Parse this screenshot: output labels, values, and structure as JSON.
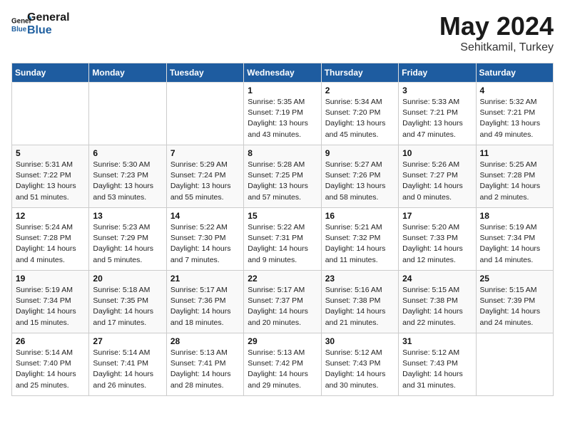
{
  "header": {
    "logo_line1": "General",
    "logo_line2": "Blue",
    "month": "May 2024",
    "location": "Sehitkamil, Turkey"
  },
  "weekdays": [
    "Sunday",
    "Monday",
    "Tuesday",
    "Wednesday",
    "Thursday",
    "Friday",
    "Saturday"
  ],
  "weeks": [
    [
      {
        "day": "",
        "info": ""
      },
      {
        "day": "",
        "info": ""
      },
      {
        "day": "",
        "info": ""
      },
      {
        "day": "1",
        "info": "Sunrise: 5:35 AM\nSunset: 7:19 PM\nDaylight: 13 hours\nand 43 minutes."
      },
      {
        "day": "2",
        "info": "Sunrise: 5:34 AM\nSunset: 7:20 PM\nDaylight: 13 hours\nand 45 minutes."
      },
      {
        "day": "3",
        "info": "Sunrise: 5:33 AM\nSunset: 7:21 PM\nDaylight: 13 hours\nand 47 minutes."
      },
      {
        "day": "4",
        "info": "Sunrise: 5:32 AM\nSunset: 7:21 PM\nDaylight: 13 hours\nand 49 minutes."
      }
    ],
    [
      {
        "day": "5",
        "info": "Sunrise: 5:31 AM\nSunset: 7:22 PM\nDaylight: 13 hours\nand 51 minutes."
      },
      {
        "day": "6",
        "info": "Sunrise: 5:30 AM\nSunset: 7:23 PM\nDaylight: 13 hours\nand 53 minutes."
      },
      {
        "day": "7",
        "info": "Sunrise: 5:29 AM\nSunset: 7:24 PM\nDaylight: 13 hours\nand 55 minutes."
      },
      {
        "day": "8",
        "info": "Sunrise: 5:28 AM\nSunset: 7:25 PM\nDaylight: 13 hours\nand 57 minutes."
      },
      {
        "day": "9",
        "info": "Sunrise: 5:27 AM\nSunset: 7:26 PM\nDaylight: 13 hours\nand 58 minutes."
      },
      {
        "day": "10",
        "info": "Sunrise: 5:26 AM\nSunset: 7:27 PM\nDaylight: 14 hours\nand 0 minutes."
      },
      {
        "day": "11",
        "info": "Sunrise: 5:25 AM\nSunset: 7:28 PM\nDaylight: 14 hours\nand 2 minutes."
      }
    ],
    [
      {
        "day": "12",
        "info": "Sunrise: 5:24 AM\nSunset: 7:28 PM\nDaylight: 14 hours\nand 4 minutes."
      },
      {
        "day": "13",
        "info": "Sunrise: 5:23 AM\nSunset: 7:29 PM\nDaylight: 14 hours\nand 5 minutes."
      },
      {
        "day": "14",
        "info": "Sunrise: 5:22 AM\nSunset: 7:30 PM\nDaylight: 14 hours\nand 7 minutes."
      },
      {
        "day": "15",
        "info": "Sunrise: 5:22 AM\nSunset: 7:31 PM\nDaylight: 14 hours\nand 9 minutes."
      },
      {
        "day": "16",
        "info": "Sunrise: 5:21 AM\nSunset: 7:32 PM\nDaylight: 14 hours\nand 11 minutes."
      },
      {
        "day": "17",
        "info": "Sunrise: 5:20 AM\nSunset: 7:33 PM\nDaylight: 14 hours\nand 12 minutes."
      },
      {
        "day": "18",
        "info": "Sunrise: 5:19 AM\nSunset: 7:34 PM\nDaylight: 14 hours\nand 14 minutes."
      }
    ],
    [
      {
        "day": "19",
        "info": "Sunrise: 5:19 AM\nSunset: 7:34 PM\nDaylight: 14 hours\nand 15 minutes."
      },
      {
        "day": "20",
        "info": "Sunrise: 5:18 AM\nSunset: 7:35 PM\nDaylight: 14 hours\nand 17 minutes."
      },
      {
        "day": "21",
        "info": "Sunrise: 5:17 AM\nSunset: 7:36 PM\nDaylight: 14 hours\nand 18 minutes."
      },
      {
        "day": "22",
        "info": "Sunrise: 5:17 AM\nSunset: 7:37 PM\nDaylight: 14 hours\nand 20 minutes."
      },
      {
        "day": "23",
        "info": "Sunrise: 5:16 AM\nSunset: 7:38 PM\nDaylight: 14 hours\nand 21 minutes."
      },
      {
        "day": "24",
        "info": "Sunrise: 5:15 AM\nSunset: 7:38 PM\nDaylight: 14 hours\nand 22 minutes."
      },
      {
        "day": "25",
        "info": "Sunrise: 5:15 AM\nSunset: 7:39 PM\nDaylight: 14 hours\nand 24 minutes."
      }
    ],
    [
      {
        "day": "26",
        "info": "Sunrise: 5:14 AM\nSunset: 7:40 PM\nDaylight: 14 hours\nand 25 minutes."
      },
      {
        "day": "27",
        "info": "Sunrise: 5:14 AM\nSunset: 7:41 PM\nDaylight: 14 hours\nand 26 minutes."
      },
      {
        "day": "28",
        "info": "Sunrise: 5:13 AM\nSunset: 7:41 PM\nDaylight: 14 hours\nand 28 minutes."
      },
      {
        "day": "29",
        "info": "Sunrise: 5:13 AM\nSunset: 7:42 PM\nDaylight: 14 hours\nand 29 minutes."
      },
      {
        "day": "30",
        "info": "Sunrise: 5:12 AM\nSunset: 7:43 PM\nDaylight: 14 hours\nand 30 minutes."
      },
      {
        "day": "31",
        "info": "Sunrise: 5:12 AM\nSunset: 7:43 PM\nDaylight: 14 hours\nand 31 minutes."
      },
      {
        "day": "",
        "info": ""
      }
    ]
  ]
}
